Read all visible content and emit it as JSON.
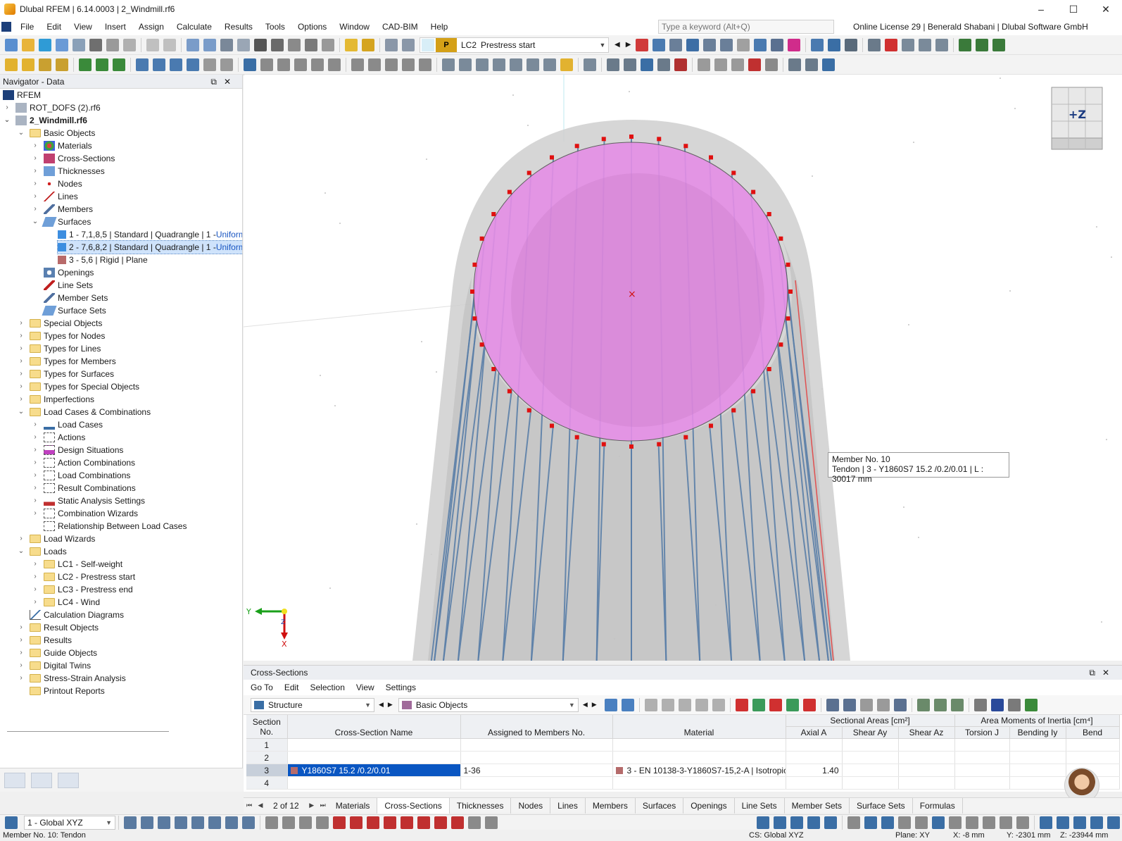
{
  "window": {
    "title": "Dlubal RFEM | 6.14.0003 | 2_Windmill.rf6",
    "controls": [
      "–",
      "☐",
      "✕"
    ]
  },
  "menu": {
    "items": [
      "File",
      "Edit",
      "View",
      "Insert",
      "Assign",
      "Calculate",
      "Results",
      "Tools",
      "Options",
      "Window",
      "CAD-BIM",
      "Help"
    ],
    "search_placeholder": "Type a keyword (Alt+Q)",
    "license": "Online License 29 | Benerald Shabani | Dlubal Software GmbH"
  },
  "loadcase": {
    "badge": "P",
    "id": "LC2",
    "name": "Prestress start"
  },
  "navigator": {
    "title": "Navigator - Data",
    "root": "RFEM",
    "files": [
      "ROT_DOFS (2).rf6",
      "2_Windmill.rf6"
    ],
    "basic_objects": "Basic Objects",
    "basic_items": [
      "Materials",
      "Cross-Sections",
      "Thicknesses",
      "Nodes",
      "Lines",
      "Members",
      "Surfaces"
    ],
    "surfaces": [
      {
        "label": "1 - 7,1,8,5 | Standard | Quadrangle | 1 - ",
        "extra": "Uniform"
      },
      {
        "label": "2 - 7,6,8,2 | Standard | Quadrangle | 1 - ",
        "extra": "Uniform"
      },
      {
        "label": "3 - 5,6 | Rigid | Plane",
        "extra": ""
      }
    ],
    "after_surfaces": [
      "Openings",
      "Line Sets",
      "Member Sets",
      "Surface Sets"
    ],
    "groups": [
      "Special Objects",
      "Types for Nodes",
      "Types for Lines",
      "Types for Members",
      "Types for Surfaces",
      "Types for Special Objects",
      "Imperfections",
      "Load Cases & Combinations"
    ],
    "lcc_items": [
      "Load Cases",
      "Actions",
      "Design Situations",
      "Action Combinations",
      "Load Combinations",
      "Result Combinations",
      "Static Analysis Settings",
      "Combination Wizards",
      "Relationship Between Load Cases"
    ],
    "load_wizards": "Load Wizards",
    "loads": "Loads",
    "loads_items": [
      "LC1 - Self-weight",
      "LC2 - Prestress start",
      "LC3 - Prestress end",
      "LC4 - Wind"
    ],
    "calc_diagrams": "Calculation Diagrams",
    "tail_groups": [
      "Result Objects",
      "Results",
      "Guide Objects",
      "Digital Twins",
      "Stress-Strain Analysis",
      "Printout Reports"
    ]
  },
  "viewport": {
    "tooltip_line1": "Member No. 10",
    "tooltip_line2": "Tendon | 3 - Y1860S7 15.2 /0.2/0.01 | L : 30017 mm",
    "axis_y": "Y",
    "axis_x": "X",
    "axis_z": "Z",
    "cube_label": "+Z",
    "colors": {
      "surface": "#e58ee6",
      "tendon": "#5b7fa8",
      "node": "#e01010",
      "shell": "#cfcfcf"
    }
  },
  "cross_sections": {
    "title": "Cross-Sections",
    "menu": [
      "Go To",
      "Edit",
      "Selection",
      "View",
      "Settings"
    ],
    "combo1": "Structure",
    "combo2": "Basic Objects",
    "header_group1": "Sectional Areas [cm²]",
    "header_group2": "Area Moments of Inertia [cm⁴]",
    "columns": [
      "Section No.",
      "Cross-Section Name",
      "Assigned to Members No.",
      "Material",
      "Axial A",
      "Shear Ay",
      "Shear Az",
      "Torsion J",
      "Bending Iy",
      "Bend"
    ],
    "rows": [
      {
        "no": "1",
        "name": "",
        "members": "",
        "material": "",
        "axial": ""
      },
      {
        "no": "2",
        "name": "",
        "members": "",
        "material": "",
        "axial": ""
      },
      {
        "no": "3",
        "name": "Y1860S7 15.2 /0.2/0.01",
        "members": "1-36",
        "material": "3 - EN 10138-3-Y1860S7-15,2-A | Isotropic |...",
        "axial": "1.40"
      },
      {
        "no": "4",
        "name": "",
        "members": "",
        "material": "",
        "axial": ""
      }
    ]
  },
  "tabs": {
    "pager": "2 of 12",
    "items": [
      "Materials",
      "Cross-Sections",
      "Thicknesses",
      "Nodes",
      "Lines",
      "Members",
      "Surfaces",
      "Openings",
      "Line Sets",
      "Member Sets",
      "Surface Sets",
      "Formulas"
    ],
    "active": "Cross-Sections"
  },
  "status": {
    "cs_combo": "1 - Global XYZ",
    "left": "Member No. 10: Tendon",
    "cs": "CS: Global XYZ",
    "plane": "Plane: XY",
    "x": "X: -8 mm",
    "y": "Y: -2301 mm",
    "z": "Z: -23944 mm"
  }
}
